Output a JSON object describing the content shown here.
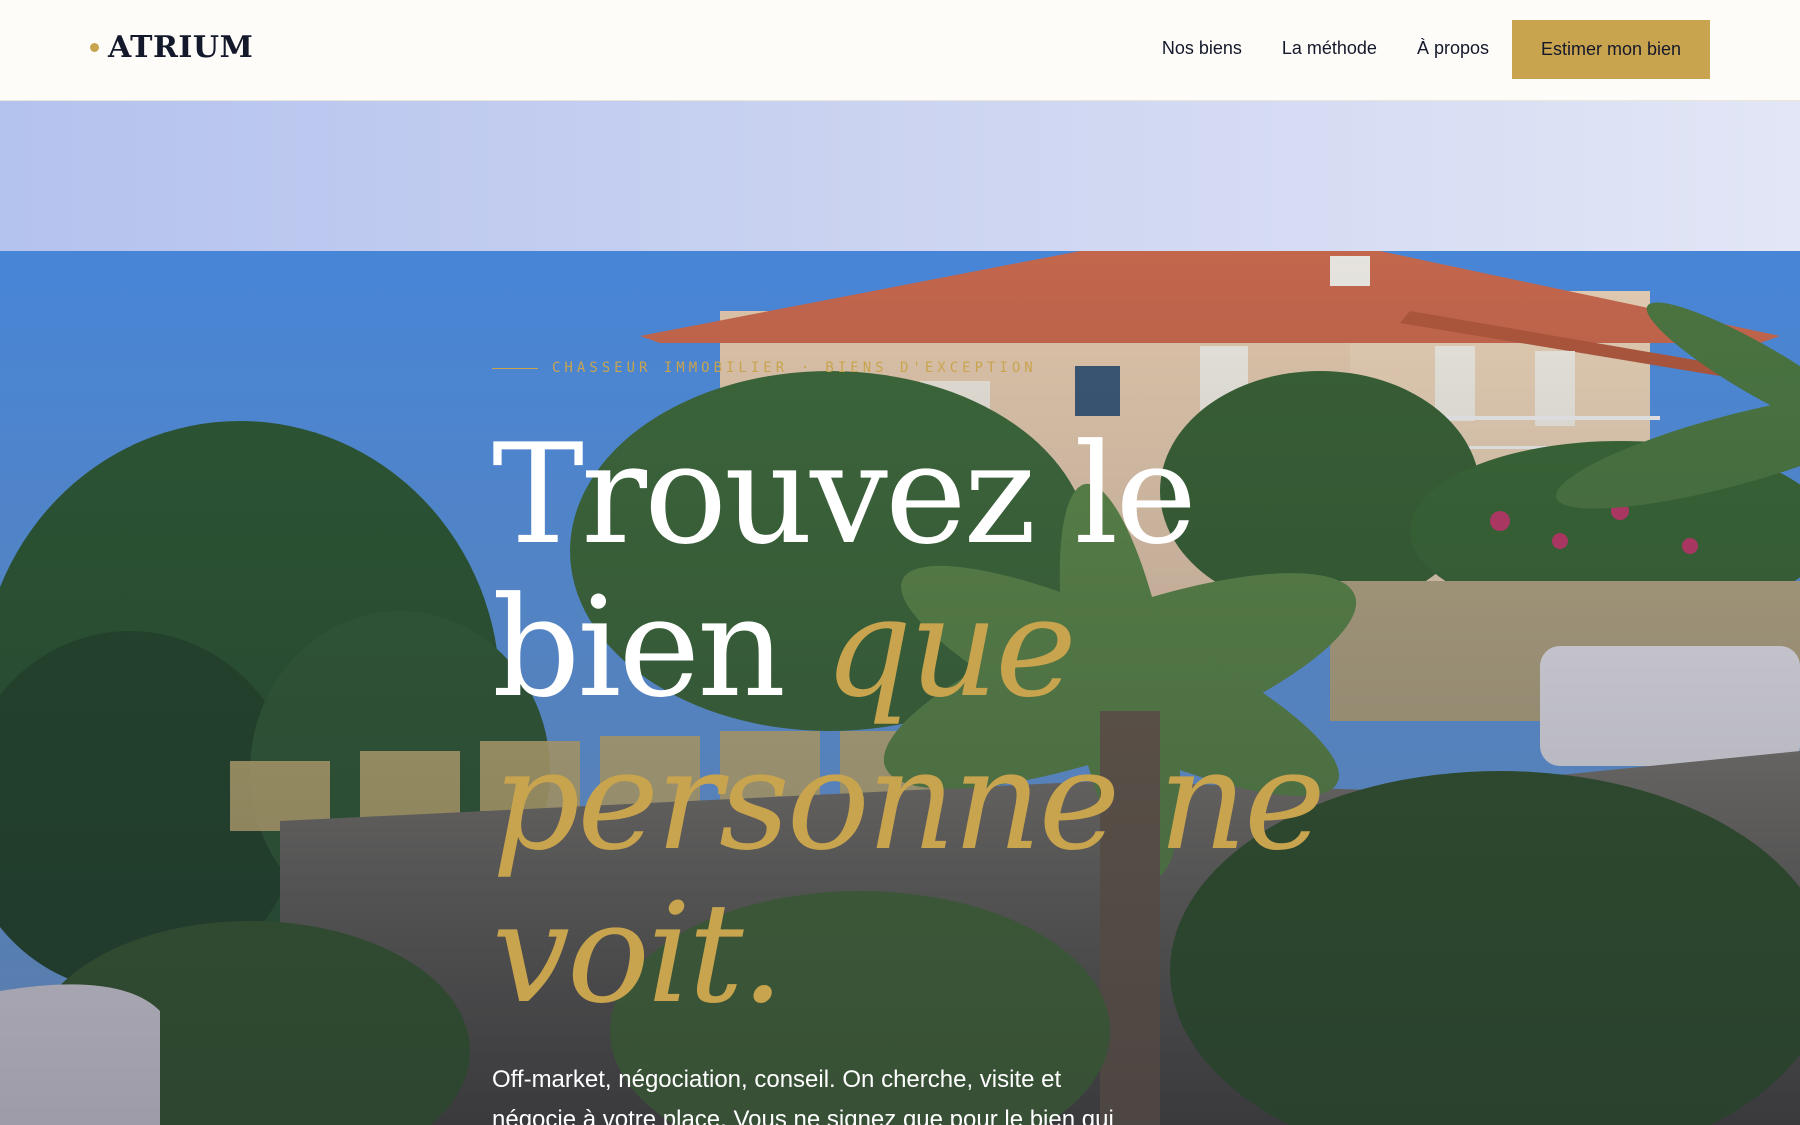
{
  "brand": {
    "name": "ATRIUM"
  },
  "nav": {
    "items": [
      {
        "label": "Nos biens"
      },
      {
        "label": "La méthode"
      },
      {
        "label": "À propos"
      }
    ],
    "cta_label": "Estimer mon bien"
  },
  "hero": {
    "eyebrow": "CHASSEUR IMMOBILIER · BIENS D'EXCEPTION",
    "title_line1": "Trouvez le",
    "title_line2_plain": "bien ",
    "title_line2_accent": "que",
    "title_line3_accent": "personne ne",
    "title_line4_accent": "voit.",
    "lead_line1": "Off-market, négociation, conseil. On cherche, visite et",
    "lead_line2": "négocie à votre place. Vous ne signez que pour le bien qui"
  },
  "colors": {
    "accent": "#c9a44e",
    "ink": "#14182b",
    "background": "#fdfcf8"
  },
  "icons": {
    "logo_mark": "dot-icon"
  }
}
